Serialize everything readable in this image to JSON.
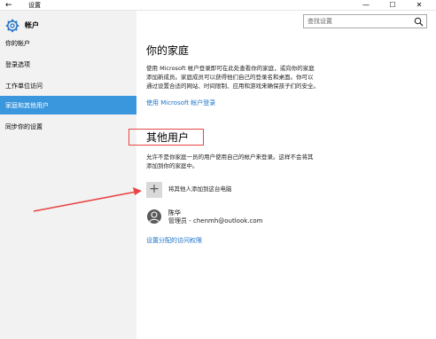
{
  "titlebar": {
    "back": "←",
    "title": "设置",
    "minimize": "—",
    "maximize": "☐",
    "close": "✕"
  },
  "sidebar": {
    "home_label": "帐户",
    "items": [
      {
        "label": "你的帐户",
        "active": false
      },
      {
        "label": "登录选项",
        "active": false
      },
      {
        "label": "工作单位访问",
        "active": false
      },
      {
        "label": "家庭和其他用户",
        "active": true
      },
      {
        "label": "同步你的设置",
        "active": false
      }
    ]
  },
  "search": {
    "placeholder": "查找设置"
  },
  "family": {
    "heading": "你的家庭",
    "description_lines": [
      "使用 Microsoft 帐户登录即可在此处查看你的家庭，或向你的家庭",
      "添加新成员。家庭成员可以获得他们自己的登录名和桌面。你可以",
      "通过设置合适的网站、时间限制、应用和游戏来确保孩子们的安全。"
    ],
    "signin_link": "使用 Microsoft 帐户登录"
  },
  "others": {
    "heading": "其他用户",
    "description_lines": [
      "允许不是你家庭一员的用户使用自己的帐户来登录。这样不会将其",
      "添加到你的家庭中。"
    ],
    "add_label": "将其他人添加到这台电脑",
    "user": {
      "name": "陈华",
      "detail": "管理员 - chenmh@outlook.com"
    },
    "assigned_access_link": "设置分配的访问权限"
  },
  "colors": {
    "accent": "#3a96dd",
    "link": "#1a73c8",
    "annotation": "#e84545"
  }
}
